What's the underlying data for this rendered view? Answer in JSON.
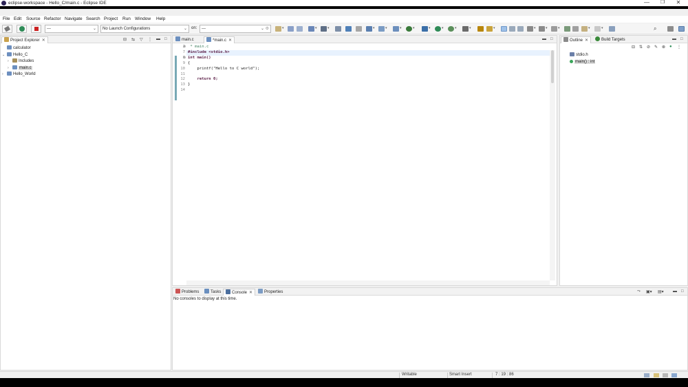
{
  "window": {
    "title": "eclipse-workspace - Hello_C/main.c - Eclipse IDE",
    "minimize": "—",
    "maximize": "❐",
    "close": "✕"
  },
  "menu": [
    "File",
    "Edit",
    "Source",
    "Refactor",
    "Navigate",
    "Search",
    "Project",
    "Run",
    "Window",
    "Help"
  ],
  "toolbar": {
    "build_combo": "---",
    "launch_config": "No Launch Configurations",
    "on_label": "on:",
    "target_combo": "---",
    "colors": {
      "run": "#2e8b57",
      "stop": "#cc2222",
      "debug": "#3a7a3a"
    }
  },
  "project_explorer": {
    "tab_label": "Project Explorer",
    "items": [
      {
        "label": "calculator",
        "indent": 0,
        "expanded": null,
        "icon": "project-icon"
      },
      {
        "label": "Hello_C",
        "indent": 0,
        "expanded": true,
        "icon": "project-icon"
      },
      {
        "label": "Includes",
        "indent": 1,
        "expanded": false,
        "icon": "includes-icon"
      },
      {
        "label": "main.c",
        "indent": 1,
        "expanded": false,
        "icon": "c-file-icon",
        "selected": true
      },
      {
        "label": "Hello_World",
        "indent": 0,
        "expanded": false,
        "icon": "project-icon"
      }
    ]
  },
  "editor": {
    "tabs": [
      {
        "label": "main.c",
        "active": false,
        "dirty": false
      },
      {
        "label": "*main.c",
        "active": true,
        "dirty": true
      }
    ],
    "lines": [
      {
        "num": "2",
        "marker": "⊕",
        "text": " * main.c"
      },
      {
        "num": "7",
        "marker": "",
        "text": "#include <stdio.h>"
      },
      {
        "num": "8",
        "marker": "⊖",
        "text": "int main()"
      },
      {
        "num": "9",
        "marker": "",
        "text": "{"
      },
      {
        "num": "10",
        "marker": "",
        "text": "    printf(\"Hello to C world\");"
      },
      {
        "num": "11",
        "marker": "",
        "text": ""
      },
      {
        "num": "12",
        "marker": "",
        "text": "    return 0;"
      },
      {
        "num": "13",
        "marker": "",
        "text": "}"
      },
      {
        "num": "14",
        "marker": "",
        "text": ""
      }
    ]
  },
  "outline": {
    "tabs": [
      "Outline",
      "Build Targets"
    ],
    "items": [
      {
        "label": "stdio.h",
        "icon": "include-icon"
      },
      {
        "label": "main() : int",
        "icon": "function-icon",
        "selected": true
      }
    ]
  },
  "bottom_panel": {
    "tabs": [
      "Problems",
      "Tasks",
      "Console",
      "Properties"
    ],
    "active_tab": "Console",
    "message": "No consoles to display at this time."
  },
  "status_bar": {
    "writable": "Writable",
    "insert_mode": "Smart Insert",
    "position": "7 : 19 : 86"
  }
}
